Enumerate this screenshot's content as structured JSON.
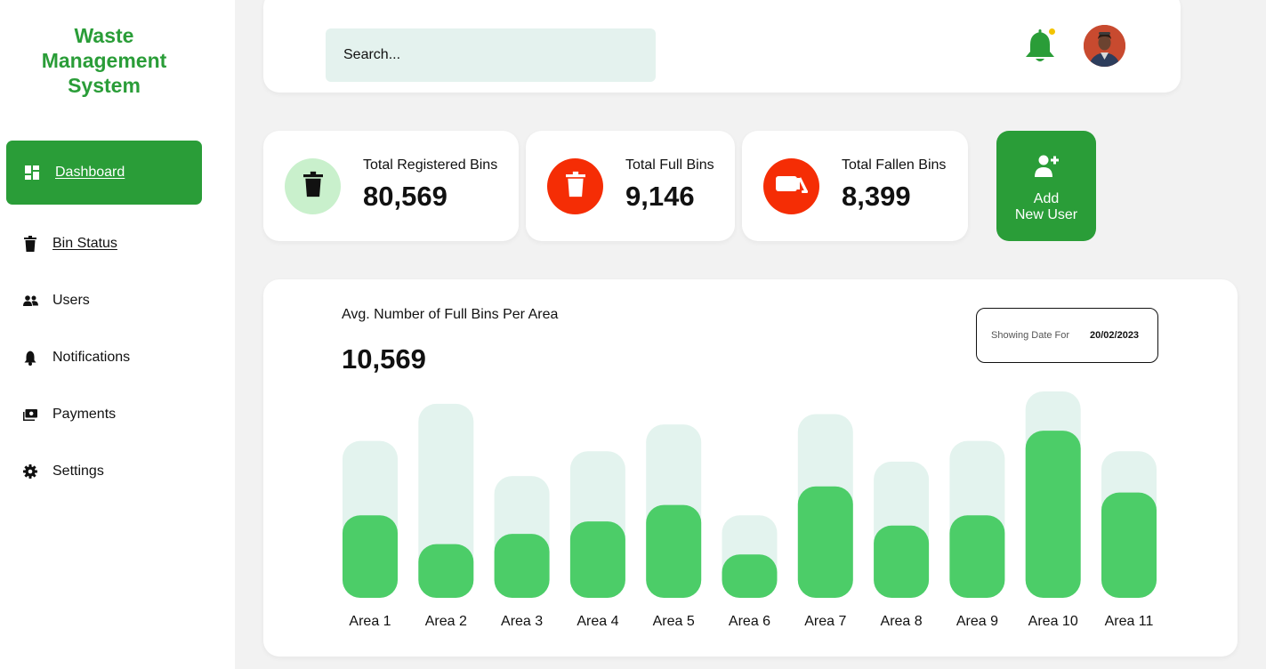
{
  "app": {
    "title_lines": [
      "Waste",
      "Management",
      "System"
    ],
    "brand_color": "#2a9d38"
  },
  "sidebar": {
    "items": [
      {
        "label": "Dashboard",
        "icon": "dashboard-icon",
        "active": true
      },
      {
        "label": "Bin Status",
        "icon": "trash-icon",
        "active": false
      },
      {
        "label": "Users",
        "icon": "users-icon",
        "active": false
      },
      {
        "label": "Notifications",
        "icon": "bell-icon",
        "active": false
      },
      {
        "label": "Payments",
        "icon": "payments-icon",
        "active": false
      },
      {
        "label": "Settings",
        "icon": "gear-icon",
        "active": false
      }
    ]
  },
  "header": {
    "search_placeholder": "Search...",
    "notification_icon": "bell-icon",
    "avatar": "avatar"
  },
  "stats": [
    {
      "title": "Total Registered Bins",
      "value": "80,569",
      "icon": "trash-icon",
      "circle_color": "#c9f0cc",
      "icon_color": "#111111"
    },
    {
      "title": "Total Full Bins",
      "value": "9,146",
      "icon": "trash-icon",
      "circle_color": "#f52d05",
      "icon_color": "#ffffff"
    },
    {
      "title": "Total Fallen Bins",
      "value": "8,399",
      "icon": "fallen-bin-icon",
      "circle_color": "#f52d05",
      "icon_color": "#ffffff"
    }
  ],
  "add_user": {
    "label_line1": "Add",
    "label_line2": "New User",
    "icon": "add-user-icon"
  },
  "chart_panel": {
    "title": "Avg. Number of Full Bins Per Area",
    "total": "10,569",
    "date_label": "Showing Date For",
    "date_value": "20/02/2023"
  },
  "chart_data": {
    "type": "bar",
    "categories": [
      "Area 1",
      "Area 2",
      "Area 3",
      "Area 4",
      "Area 5",
      "Area 6",
      "Area 7",
      "Area 8",
      "Area 9",
      "Area 10",
      "Area 11"
    ],
    "series": [
      {
        "values": [
          0.76,
          0.94,
          0.59,
          0.71,
          0.84,
          0.4,
          0.89,
          0.66,
          0.76,
          1.0,
          0.71
        ]
      },
      {
        "values": [
          0.4,
          0.26,
          0.31,
          0.37,
          0.45,
          0.21,
          0.54,
          0.35,
          0.4,
          0.81,
          0.51
        ]
      }
    ],
    "colors": {
      "capacity": "#e3f3ee",
      "full": "#4ccd68"
    },
    "ylim": [
      0,
      1
    ],
    "grid": false,
    "legend": "none"
  }
}
